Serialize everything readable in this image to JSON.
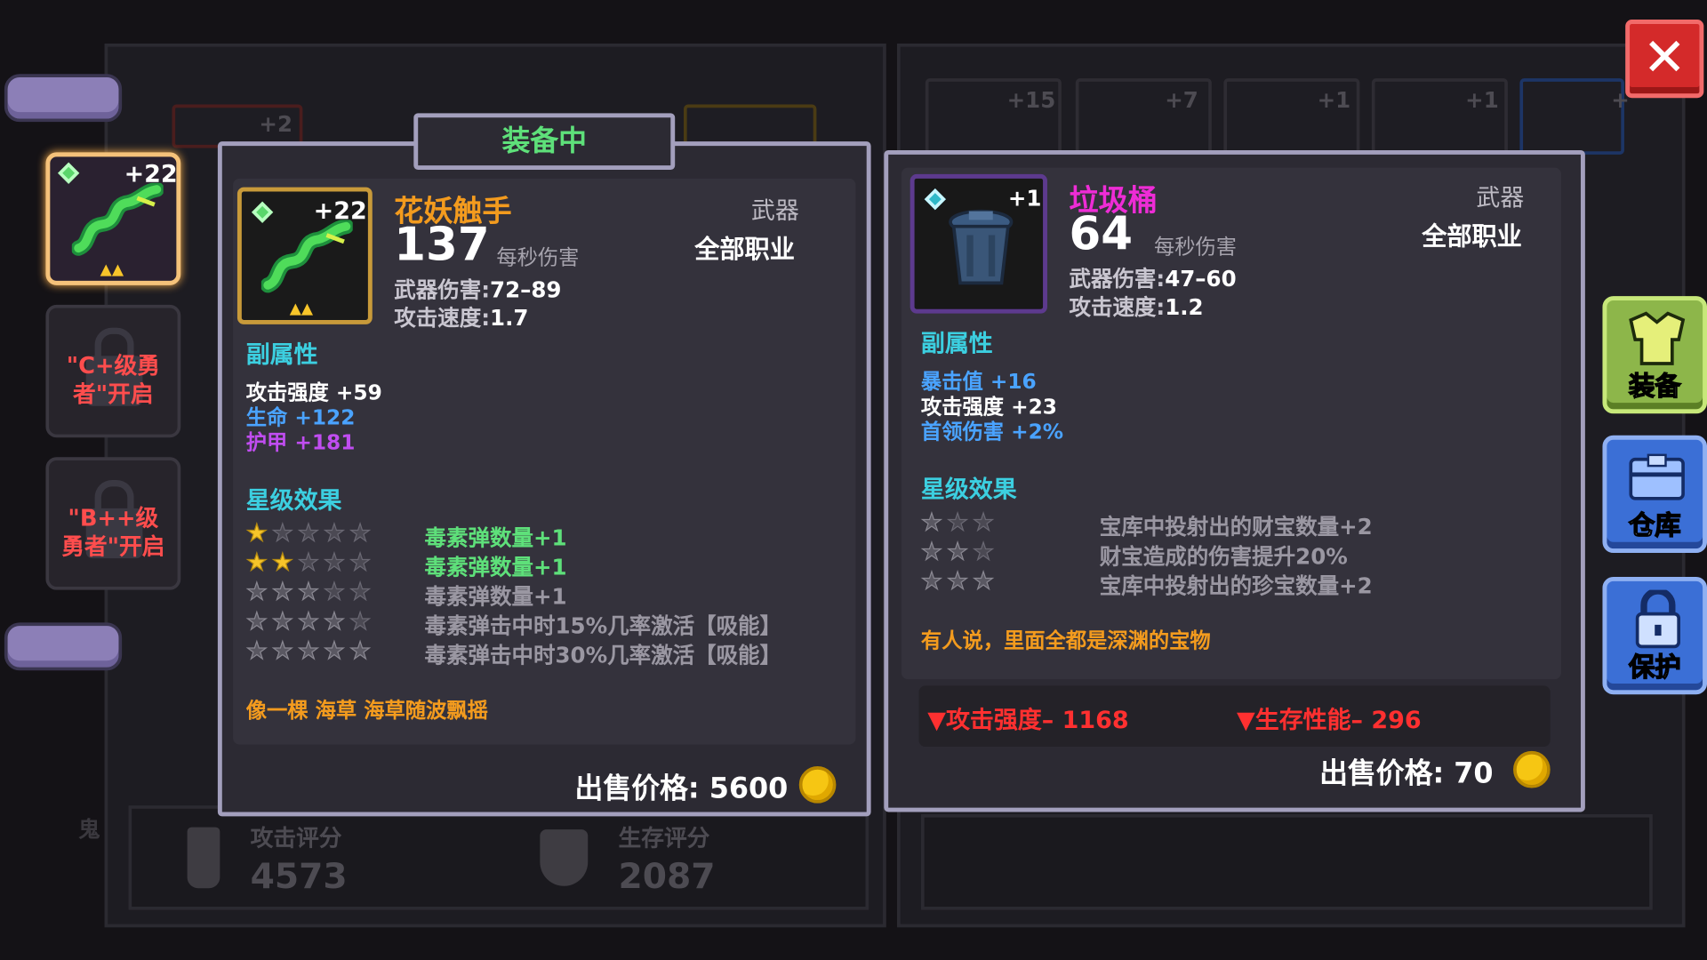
{
  "left_panel": {
    "active_slot": {
      "level": "+22"
    },
    "locked_slot_1": {
      "text": "\"C+级勇者\"开启"
    },
    "locked_slot_2": {
      "text": "\"B++级勇者\"开启"
    }
  },
  "background": {
    "attack_score_label": "攻击评分",
    "attack_score_value": "4573",
    "survival_score_label": "生存评分",
    "survival_score_value": "2087",
    "top_slot_level": "+2",
    "inventory_levels": [
      "+15",
      "+7",
      "+1",
      "+1",
      "+"
    ],
    "side_label": "鬼"
  },
  "equipped_tab": "装备中",
  "equipped_card": {
    "level": "+22",
    "name": "花妖触手",
    "type": "武器",
    "class": "全部职业",
    "dps": "137",
    "dps_label": "每秒伤害",
    "weapon_damage_label": "武器伤害:",
    "weapon_damage_value": "72–89",
    "attack_speed_label": "攻击速度:",
    "attack_speed_value": "1.7",
    "sub_attr_title": "副属性",
    "sub_attrs": [
      {
        "text": "攻击强度 +59",
        "color": "#ffffff"
      },
      {
        "text": "生命 +122",
        "color": "#4aa3ff"
      },
      {
        "text": "护甲 +181",
        "color": "#c04df0"
      }
    ],
    "star_title": "星级效果",
    "star_effects": [
      {
        "stars": 1,
        "text": "毒素弹数量+1",
        "active": true
      },
      {
        "stars": 2,
        "text": "毒素弹数量+1",
        "active": true
      },
      {
        "stars": 3,
        "text": "毒素弹数量+1",
        "active": false
      },
      {
        "stars": 4,
        "text": "毒素弹击中时15%几率激活【吸能】",
        "active": false
      },
      {
        "stars": 5,
        "text": "毒素弹击中时30%几率激活【吸能】",
        "active": false
      }
    ],
    "flavor": "像一棵 海草 海草随波飘摇",
    "sell_label": "出售价格: 5600"
  },
  "compare_card": {
    "level": "+1",
    "name": "垃圾桶",
    "type": "武器",
    "class": "全部职业",
    "dps": "64",
    "dps_label": "每秒伤害",
    "weapon_damage_label": "武器伤害:",
    "weapon_damage_value": "47–60",
    "attack_speed_label": "攻击速度:",
    "attack_speed_value": "1.2",
    "sub_attr_title": "副属性",
    "sub_attrs": [
      {
        "text": "暴击值 +16",
        "color": "#4aa3ff"
      },
      {
        "text": "攻击强度 +23",
        "color": "#ffffff"
      },
      {
        "text": "首领伤害 +2%",
        "color": "#4aa3ff"
      }
    ],
    "star_title": "星级效果",
    "star_effects": [
      {
        "stars": 1,
        "text": "宝库中投射出的财宝数量+2"
      },
      {
        "stars": 2,
        "text": "财宝造成的伤害提升20%"
      },
      {
        "stars": 3,
        "text": "宝库中投射出的珍宝数量+2"
      }
    ],
    "flavor": "有人说，里面全都是深渊的宝物",
    "diff_attack": "▼攻击强度– 1168",
    "diff_survival": "▼生存性能– 296",
    "sell_label": "出售价格: 70"
  },
  "right_buttons": {
    "equip": "装备",
    "storage": "仓库",
    "protect": "保护"
  },
  "close_icon": "✕",
  "colors": {
    "card_border": "#a39fbd",
    "orange_title": "#f39b1e",
    "pink_title": "#ee2cd6",
    "section_cyan": "#3ccfe0",
    "star_effect_green": "#5ee07a",
    "diff_red": "#ff3030"
  }
}
